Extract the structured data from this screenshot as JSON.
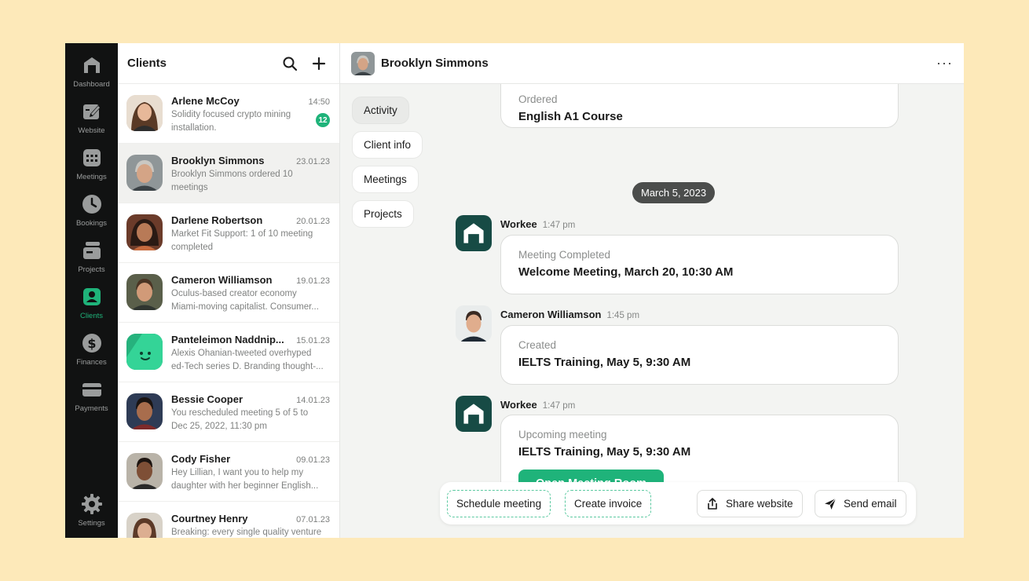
{
  "nav": {
    "items": [
      {
        "label": "Dashboard",
        "icon": "dashboard-logo-icon"
      },
      {
        "label": "Website",
        "icon": "website-edit-icon"
      },
      {
        "label": "Meetings",
        "icon": "calendar-icon"
      },
      {
        "label": "Bookings",
        "icon": "clock-icon"
      },
      {
        "label": "Projects",
        "icon": "projects-icon"
      },
      {
        "label": "Clients",
        "icon": "clients-icon",
        "active": true
      },
      {
        "label": "Finances",
        "icon": "dollar-icon"
      },
      {
        "label": "Payments",
        "icon": "card-icon"
      }
    ],
    "settings": "Settings"
  },
  "clients": {
    "title": "Clients",
    "list": [
      {
        "name": "Arlene McCoy",
        "date": "14:50",
        "msg": "Solidity focused crypto mining installation.",
        "unread": "12"
      },
      {
        "name": "Brooklyn Simmons",
        "date": "23.01.23",
        "msg": "Brooklyn Simmons ordered 10 meetings"
      },
      {
        "name": "Darlene Robertson",
        "date": "20.01.23",
        "msg": "Market Fit Support: 1 of 10 meeting completed"
      },
      {
        "name": "Cameron Williamson",
        "date": "19.01.23",
        "msg": "Oculus-based creator economy Miami-moving capitalist. Consumer..."
      },
      {
        "name": "Panteleimon Naddnip...",
        "date": "15.01.23",
        "msg": "Alexis Ohanian-tweeted overhyped ed-Tech series D. Branding thought-..."
      },
      {
        "name": "Bessie Cooper",
        "date": "14.01.23",
        "msg": "You rescheduled meeting 5 of 5 to Dec 25, 2022, 11:30 pm"
      },
      {
        "name": "Cody Fisher",
        "date": "09.01.23",
        "msg": "Hey Lillian, I want you to help my daughter with her beginner English..."
      },
      {
        "name": "Courtney Henry",
        "date": "07.01.23",
        "msg": "Breaking: every single quality venture"
      }
    ]
  },
  "main": {
    "header_name": "Brooklyn Simmons",
    "tabs": [
      "Activity",
      "Client info",
      "Meetings",
      "Projects"
    ],
    "top_card": {
      "kind": "Ordered",
      "value": "English A1 Course"
    },
    "date_pill": "March 5, 2023",
    "messages": [
      {
        "sender": "Workee",
        "time": "1:47 pm",
        "kind": "Meeting Completed",
        "value": "Welcome Meeting, March 20, 10:30 AM"
      },
      {
        "sender": "Cameron Williamson",
        "time": "1:45 pm",
        "kind": "Created",
        "value": "IELTS Training, May 5, 9:30 AM"
      },
      {
        "sender": "Workee",
        "time": "1:47 pm",
        "kind": "Upcoming meeting",
        "value": "IELTS Training, May 5, 9:30 AM",
        "button": "Open Meeting Room"
      }
    ],
    "actions": {
      "schedule": "Schedule meeting",
      "invoice": "Create invoice",
      "share": "Share website",
      "email": "Send email"
    }
  },
  "colors": {
    "accent": "#1fb37a",
    "rail": "#111212",
    "background": "#fde9b9"
  }
}
